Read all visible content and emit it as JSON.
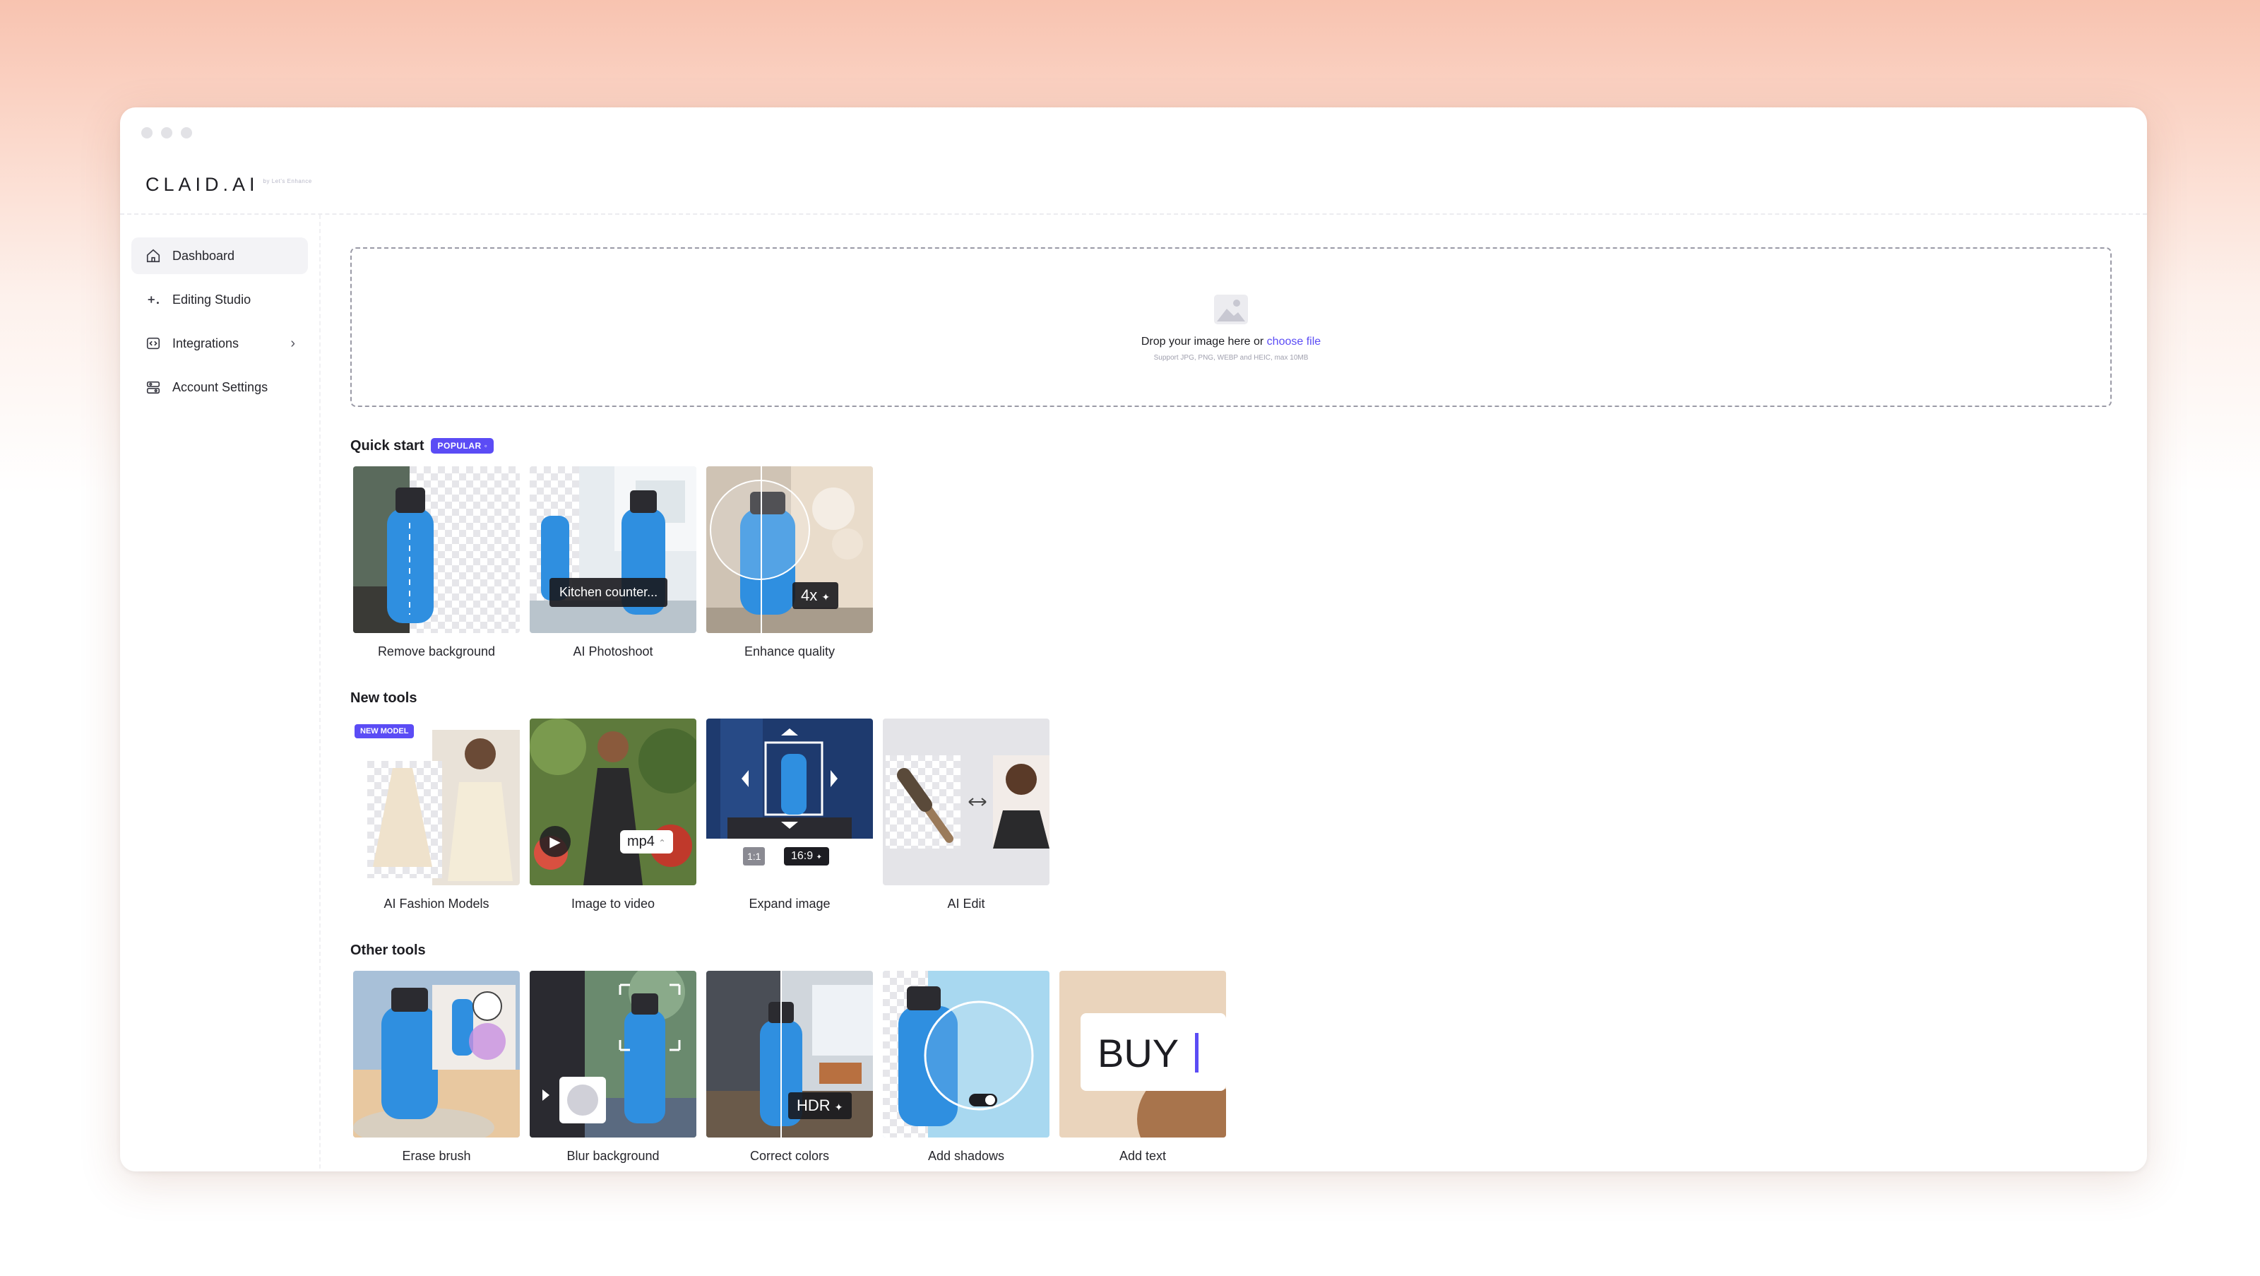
{
  "app": {
    "logo": "CLAID.AI",
    "logo_sub": "by Let's Enhance"
  },
  "sidebar": {
    "items": [
      {
        "label": "Dashboard",
        "icon": "home-icon",
        "active": true
      },
      {
        "label": "Editing Studio",
        "icon": "sparkle-plus-icon"
      },
      {
        "label": "Integrations",
        "icon": "code-icon",
        "has_chevron": true
      },
      {
        "label": "Account Settings",
        "icon": "settings-icon"
      }
    ]
  },
  "upload": {
    "text": "Drop your image here or ",
    "link": "choose file",
    "subtext": "Support JPG, PNG, WEBP and HEIC, max 10MB"
  },
  "quick_start": {
    "title": "Quick start",
    "badge": "POPULAR",
    "tools": [
      {
        "label": "Remove background"
      },
      {
        "label": "AI Photoshoot",
        "overlay": "Kitchen counter..."
      },
      {
        "label": "Enhance quality",
        "overlay": "4x"
      }
    ]
  },
  "new_tools": {
    "title": "New tools",
    "tools": [
      {
        "label": "AI Fashion Models",
        "badge": "NEW MODEL"
      },
      {
        "label": "Image to video",
        "overlay": "mp4"
      },
      {
        "label": "Expand image",
        "ratio_a": "1:1",
        "ratio_b": "16:9"
      },
      {
        "label": "AI Edit"
      }
    ]
  },
  "other_tools": {
    "title": "Other tools",
    "tools": [
      {
        "label": "Erase brush"
      },
      {
        "label": "Blur background"
      },
      {
        "label": "Correct colors",
        "overlay": "HDR"
      },
      {
        "label": "Add shadows"
      },
      {
        "label": "Add text",
        "overlay": "BUY"
      }
    ]
  },
  "colors": {
    "accent": "#5b4cf5",
    "bottle": "#2f8fe0"
  }
}
